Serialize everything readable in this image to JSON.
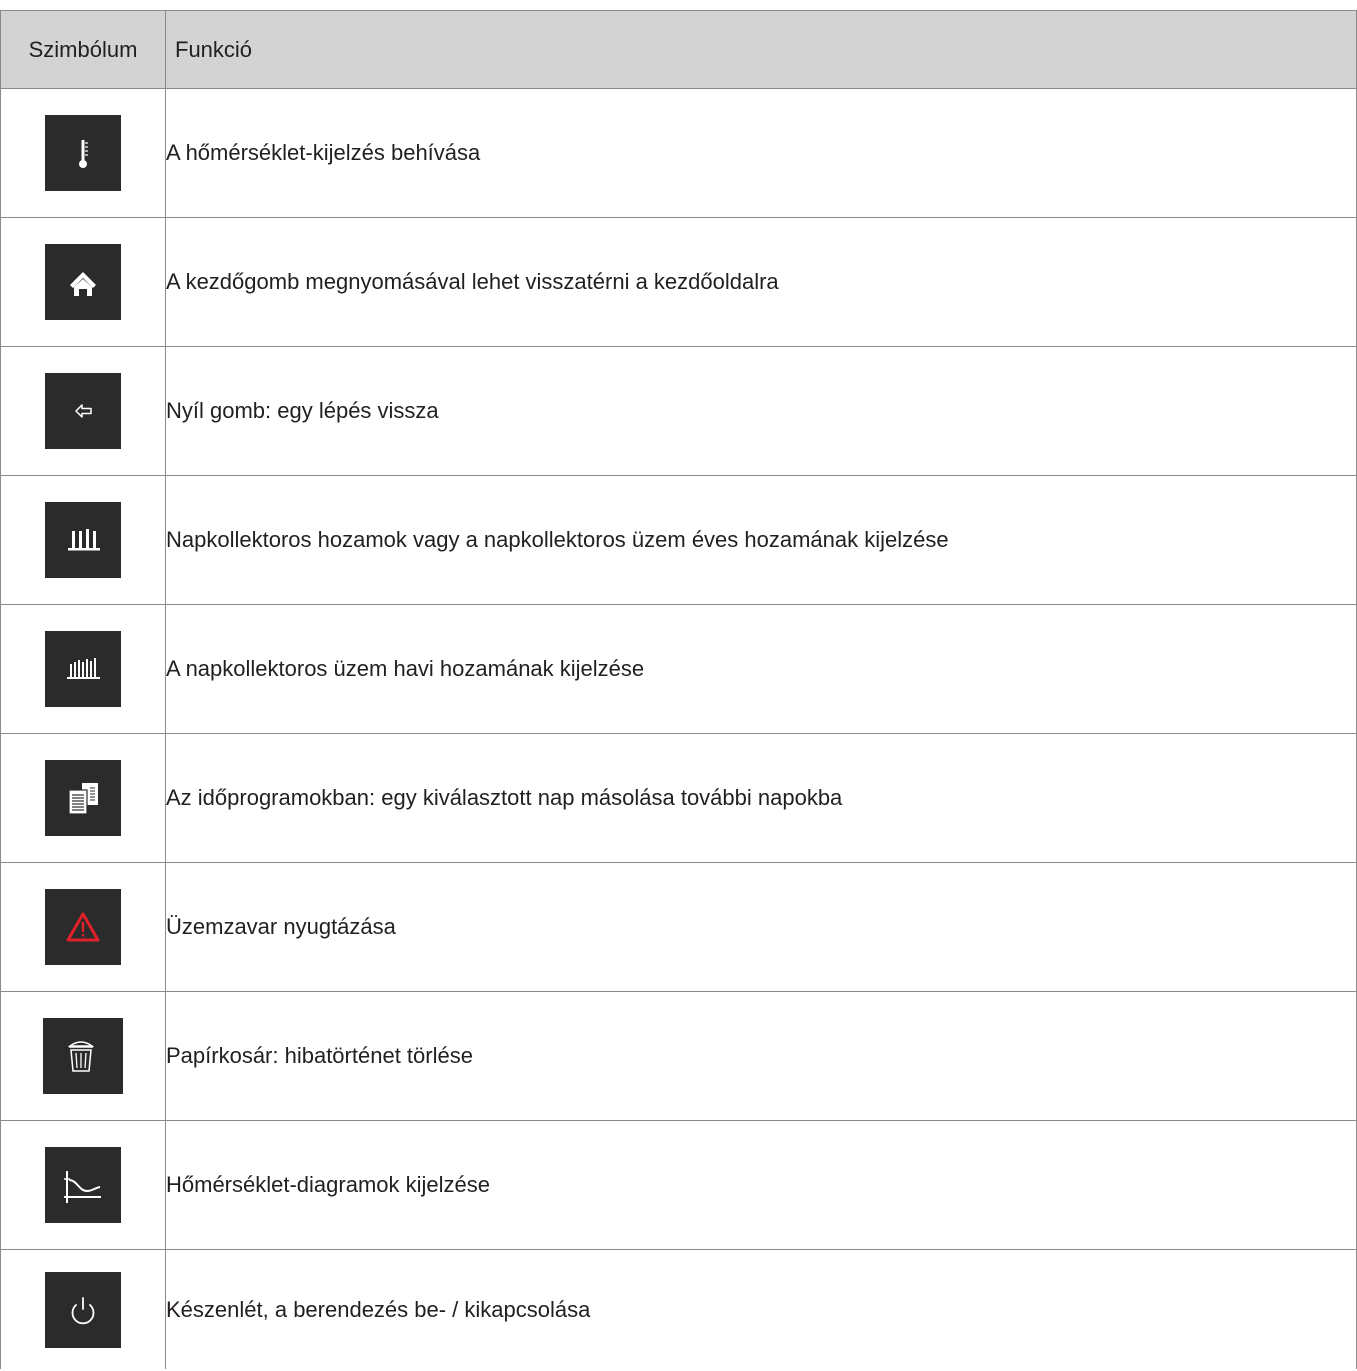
{
  "header": {
    "symbol": "Szimbólum",
    "function": "Funkció"
  },
  "rows": [
    {
      "icon": "thermometer-icon",
      "text": "A hőmérséklet-kijelzés behívása"
    },
    {
      "icon": "home-icon",
      "text": "A kezdőgomb megnyomásával lehet visszatérni a kezdőoldalra"
    },
    {
      "icon": "arrow-left-icon",
      "text": "Nyíl gomb: egy lépés vissza"
    },
    {
      "icon": "yearly-bars-icon",
      "text": "Napkollektoros hozamok vagy a napkollektoros üzem éves hozamának kijelzése"
    },
    {
      "icon": "monthly-bars-icon",
      "text": "A napkollektoros üzem havi hozamának kijelzése"
    },
    {
      "icon": "copy-icon",
      "text": "Az időprogramokban: egy kiválasztott nap másolása további napokba"
    },
    {
      "icon": "warning-icon",
      "text": "Üzemzavar nyugtázása"
    },
    {
      "icon": "trash-icon",
      "text": "Papírkosár: hibatörténet törlése"
    },
    {
      "icon": "temperature-chart-icon",
      "text": "Hőmérséklet-diagramok kijelzése"
    },
    {
      "icon": "power-icon",
      "text": "Készenlét, a berendezés be- / kikapcsolása"
    }
  ],
  "colors": {
    "icon_bg": "#2b2b2b",
    "header_bg": "#d3d3d3",
    "warning": "#e2202a"
  }
}
